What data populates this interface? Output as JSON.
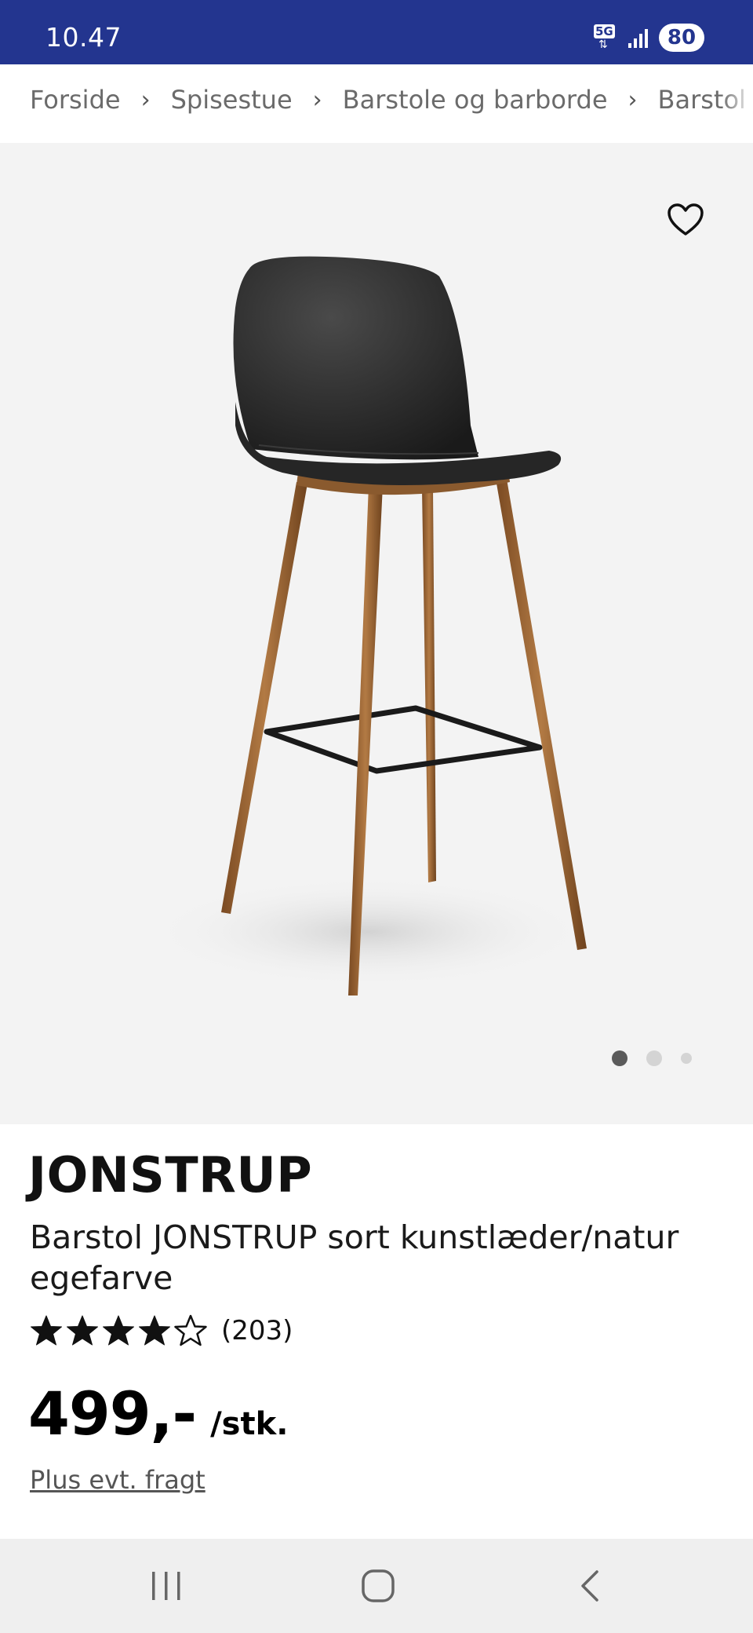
{
  "status_bar": {
    "time": "10.47",
    "network": "5G",
    "battery": "80"
  },
  "breadcrumb": {
    "items": [
      "Forside",
      "Spisestue",
      "Barstole og barborde",
      "Barstol JONSTRUP"
    ],
    "separator": "›"
  },
  "gallery": {
    "image": "barstool-black-leather-oak-legs",
    "current_slide": 1,
    "slide_count": 3
  },
  "product": {
    "brand": "JONSTRUP",
    "description": "Barstol JONSTRUP sort kunstlæder/natur egefarve",
    "rating": 4,
    "rating_max": 5,
    "review_count": "(203)",
    "price": "499,-",
    "price_unit": "/stk.",
    "shipping_note": "Plus evt. fragt"
  },
  "icons": {
    "favorite": "heart-outline-icon",
    "nav_recent": "recent-apps-icon",
    "nav_home": "home-icon",
    "nav_back": "back-icon"
  },
  "colors": {
    "status_bar": "#23358f",
    "gallery_bg": "#f3f3f3",
    "nav_bg": "#efefef"
  }
}
